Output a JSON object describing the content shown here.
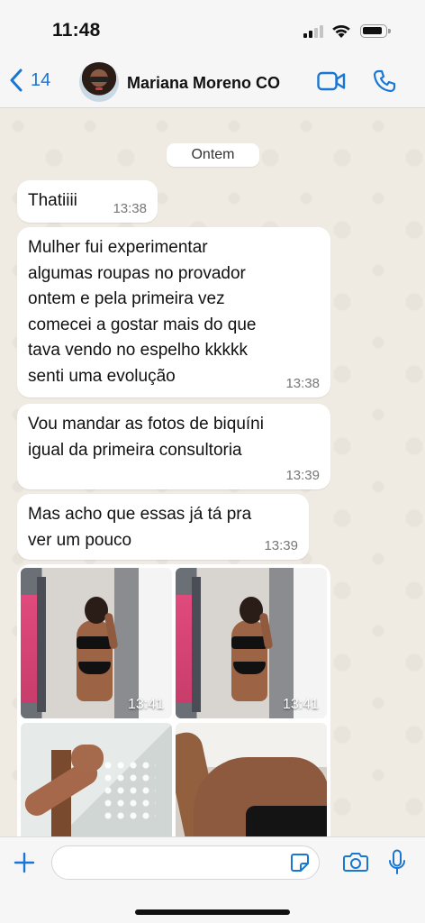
{
  "status_bar": {
    "time": "11:48"
  },
  "header": {
    "back_count": "14",
    "contact_name": "Mariana Moreno CO"
  },
  "chat": {
    "date_separator": "Ontem",
    "messages": [
      {
        "text": "Thatiiii",
        "time": "13:38"
      },
      {
        "text": "Mulher fui experimentar\nalgumas roupas no provador\nontem e pela primeira vez\ncomecei a gostar mais do que\ntava vendo no espelho kkkkk\nsenti uma evolução",
        "time": "13:38"
      },
      {
        "text": "Vou mandar as fotos de biquíni\nigual da primeira consultoria",
        "time": "13:39"
      },
      {
        "text": "Mas acho que essas já tá pra\nver um pouco",
        "time": "13:39"
      }
    ],
    "photos": [
      {
        "time": "13:41"
      },
      {
        "time": "13:41"
      },
      {
        "time": ""
      },
      {
        "time": ""
      }
    ]
  },
  "input": {
    "placeholder": ""
  },
  "colors": {
    "accent": "#1976d2",
    "chat_bg": "#efeae2",
    "bubble": "#ffffff"
  },
  "icons": [
    "chevron-left-icon",
    "video-call-icon",
    "phone-icon",
    "plus-icon",
    "sticker-icon",
    "camera-icon",
    "mic-icon"
  ]
}
